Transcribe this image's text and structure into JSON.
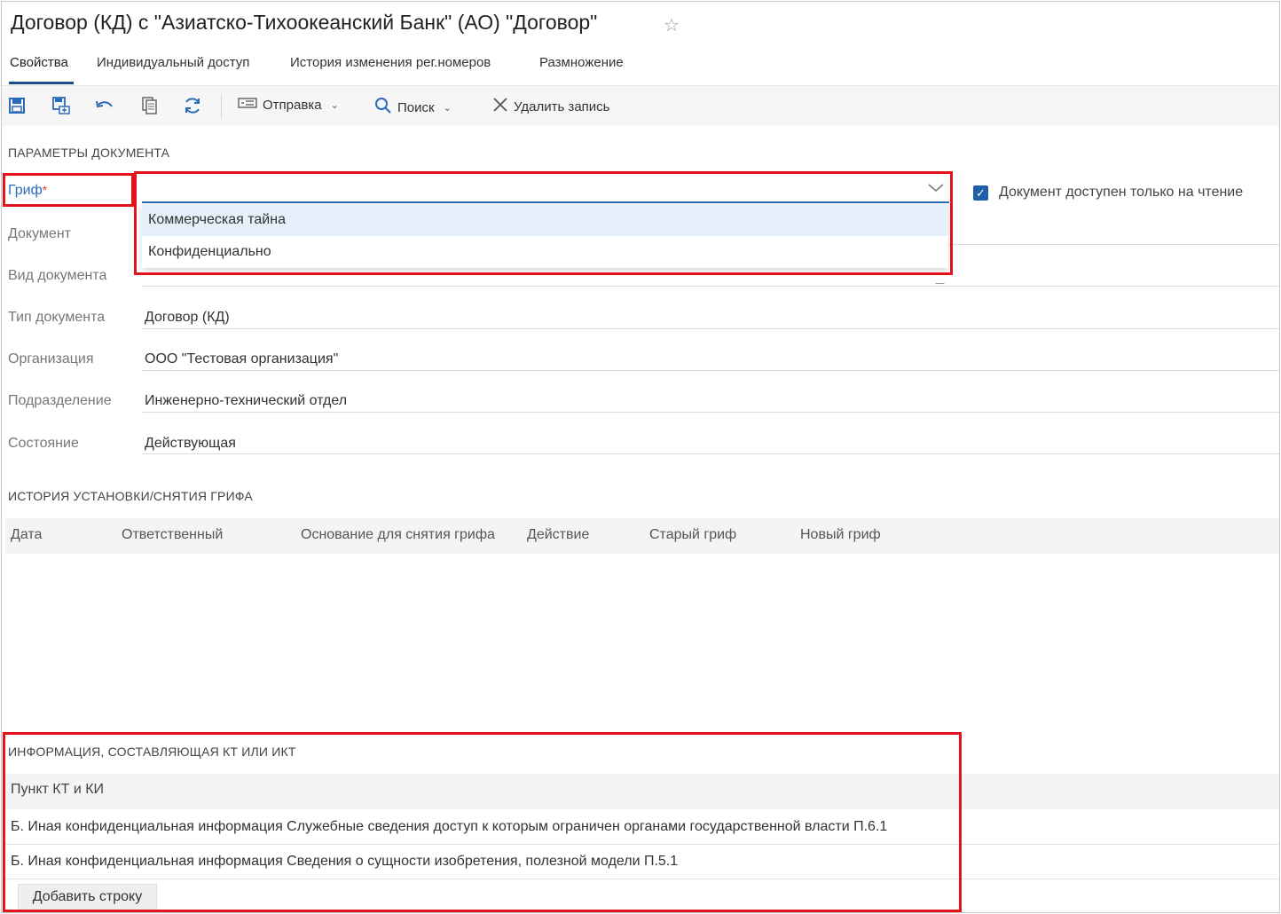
{
  "window": {
    "title": "Договор (КД) с \"Азиатско-Тихоокеанский Банк\" (АО) \"Договор\"",
    "favorite_icon": "star-icon"
  },
  "tabs": [
    {
      "label": "Свойства",
      "active": true
    },
    {
      "label": "Индивидуальный доступ",
      "active": false
    },
    {
      "label": "История изменения рег.номеров",
      "active": false
    },
    {
      "label": "Размножение",
      "active": false
    }
  ],
  "toolbar": {
    "icons": [
      "save-icon",
      "save-as-icon",
      "undo-icon",
      "copy-icon",
      "refresh-icon"
    ],
    "send_label": "Отправка",
    "search_label": "Поиск",
    "delete_label": "Удалить запись"
  },
  "params": {
    "section_title": "ПАРАМЕТРЫ ДОКУМЕНТА",
    "grif_label": "Гриф",
    "grif_required_mark": "*",
    "grif_value": "",
    "grif_options": [
      "Коммерческая тайна",
      "Конфиденциально"
    ],
    "readonly_checkbox": {
      "checked": true,
      "label": "Документ доступен только на чтение"
    },
    "fields": [
      {
        "label": "Документ",
        "value": ""
      },
      {
        "label": "Вид документа",
        "value": ""
      },
      {
        "label": "Тип документа",
        "value": "Договор (КД)"
      },
      {
        "label": "Организация",
        "value": "ООО \"Тестовая организация\""
      },
      {
        "label": "Подразделение",
        "value": "Инженерно-технический отдел"
      },
      {
        "label": "Состояние",
        "value": "Действующая"
      }
    ]
  },
  "history": {
    "section_title": "ИСТОРИЯ УСТАНОВКИ/СНЯТИЯ ГРИФА",
    "columns": [
      "Дата",
      "Ответственный",
      "Основание для снятия грифа",
      "Действие",
      "Старый гриф",
      "Новый гриф"
    ],
    "rows": []
  },
  "kt_info": {
    "section_title": "ИНФОРМАЦИЯ, СОСТАВЛЯЮЩАЯ КТ ИЛИ ИКТ",
    "column": "Пункт КТ и КИ",
    "rows": [
      "Б. Иная конфиденциальная информация Служебные сведения доступ к которым ограничен органами государственной власти П.6.1",
      "Б. Иная конфиденциальная информация Сведения о сущности изобретения, полезной модели П.5.1"
    ],
    "add_row_label": "Добавить строку"
  },
  "colors": {
    "accent": "#2a6bb8",
    "highlight_box": "#e2131b",
    "dropdown_hover": "#e5f0fa"
  }
}
